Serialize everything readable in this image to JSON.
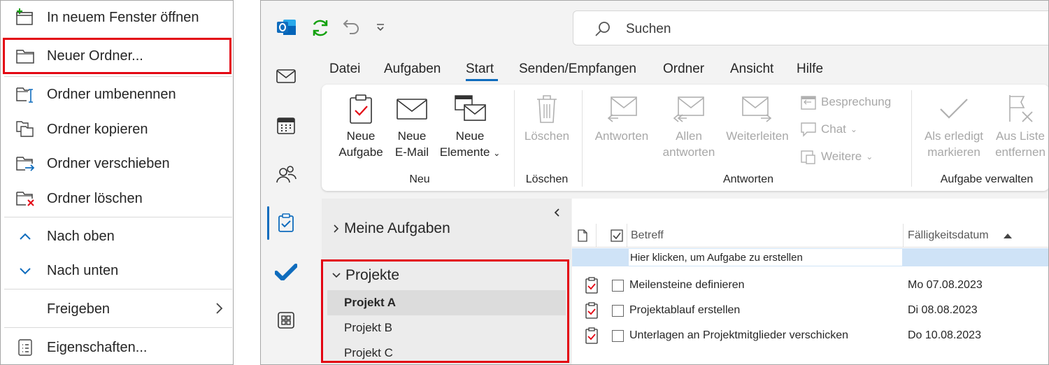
{
  "context_menu": {
    "items": [
      {
        "label": "In neuem Fenster öffnen",
        "icon": "new-window-icon"
      },
      {
        "label": "Neuer Ordner...",
        "icon": "new-folder-icon"
      },
      {
        "label": "Ordner umbenennen",
        "icon": "rename-folder-icon"
      },
      {
        "label": "Ordner kopieren",
        "icon": "copy-folder-icon"
      },
      {
        "label": "Ordner verschieben",
        "icon": "move-folder-icon"
      },
      {
        "label": "Ordner löschen",
        "icon": "delete-folder-icon"
      },
      {
        "label": "Nach oben",
        "icon": "chevron-up-icon"
      },
      {
        "label": "Nach unten",
        "icon": "chevron-down-icon"
      },
      {
        "label": "Freigeben",
        "icon": "",
        "submenu": true
      },
      {
        "label": "Eigenschaften...",
        "icon": "properties-icon"
      }
    ]
  },
  "titlebar": {
    "search_placeholder": "Suchen"
  },
  "menu_tabs": [
    "Datei",
    "Aufgaben",
    "Start",
    "Senden/Empfangen",
    "Ordner",
    "Ansicht",
    "Hilfe"
  ],
  "active_tab": "Start",
  "ribbon": {
    "neue_aufgabe": [
      "Neue",
      "Aufgabe"
    ],
    "neue_email": [
      "Neue",
      "E-Mail"
    ],
    "neue_elemente": [
      "Neue",
      "Elemente"
    ],
    "loeschen": "Löschen",
    "antworten": "Antworten",
    "allen_antworten": [
      "Allen",
      "antworten"
    ],
    "weiterleiten": "Weiterleiten",
    "besprechung": "Besprechung",
    "chat": "Chat",
    "weitere": "Weitere",
    "als_erledigt": [
      "Als erledigt",
      "markieren"
    ],
    "aus_liste": [
      "Aus Liste",
      "entfernen"
    ],
    "groups": {
      "neu": "Neu",
      "loeschen": "Löschen",
      "antworten": "Antworten",
      "aufgabe_verwalten": "Aufgabe verwalten"
    }
  },
  "folders": {
    "meine_aufgaben": "Meine Aufgaben",
    "projekte": "Projekte",
    "items": [
      "Projekt A",
      "Projekt B",
      "Projekt C"
    ],
    "selected": "Projekt A"
  },
  "tasks": {
    "col_subject": "Betreff",
    "col_due": "Fälligkeitsdatum",
    "new_task_prompt": "Hier klicken, um Aufgabe zu erstellen",
    "rows": [
      {
        "subject": "Meilensteine definieren",
        "due": "Mo 07.08.2023"
      },
      {
        "subject": "Projektablauf erstellen",
        "due": "Di 08.08.2023"
      },
      {
        "subject": "Unterlagen an Projektmitglieder verschicken",
        "due": "Do 10.08.2023"
      }
    ]
  },
  "colors": {
    "highlight_red": "#e30613",
    "accent_blue": "#0f6cbd",
    "outlook_blue": "#0364b8",
    "sync_green": "#13a10e"
  }
}
